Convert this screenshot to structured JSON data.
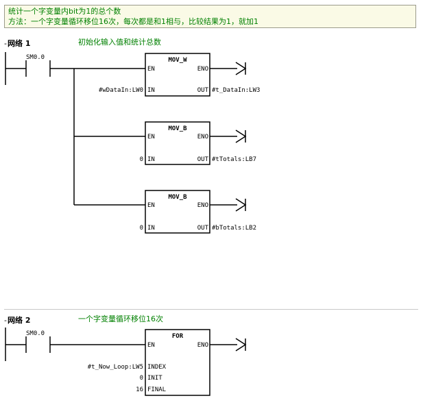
{
  "header_comment": {
    "line1": "统计一个字变量内bit为1的总个数",
    "line2": "方法：一个字变量循环移位16次，每次都是和1相与，比较结果为1，就加1"
  },
  "networks": [
    {
      "toggle": "-",
      "title": "网络 1",
      "comment": "初始化输入值和统计总数",
      "contact": "SM0.0",
      "blocks": [
        {
          "name": "MOV_W",
          "en": "EN",
          "eno": "ENO",
          "in_pin": "IN",
          "out_pin": "OUT",
          "in_value": "#wDataIn:LW0",
          "out_value": "#t_DataIn:LW3"
        },
        {
          "name": "MOV_B",
          "en": "EN",
          "eno": "ENO",
          "in_pin": "IN",
          "out_pin": "OUT",
          "in_value": "0",
          "out_value": "#tTotals:LB7"
        },
        {
          "name": "MOV_B",
          "en": "EN",
          "eno": "ENO",
          "in_pin": "IN",
          "out_pin": "OUT",
          "in_value": "0",
          "out_value": "#bTotals:LB2"
        }
      ]
    },
    {
      "toggle": "-",
      "title": "网络 2",
      "comment": "一个字变量循环移位16次",
      "contact": "SM0.0",
      "blocks": [
        {
          "name": "FOR",
          "en": "EN",
          "eno": "ENO",
          "index_pin": "INDEX",
          "init_pin": "INIT",
          "final_pin": "FINAL",
          "index_value": "#t_Now_Loop:LW5",
          "init_value": "0",
          "final_value": "16"
        }
      ]
    }
  ]
}
